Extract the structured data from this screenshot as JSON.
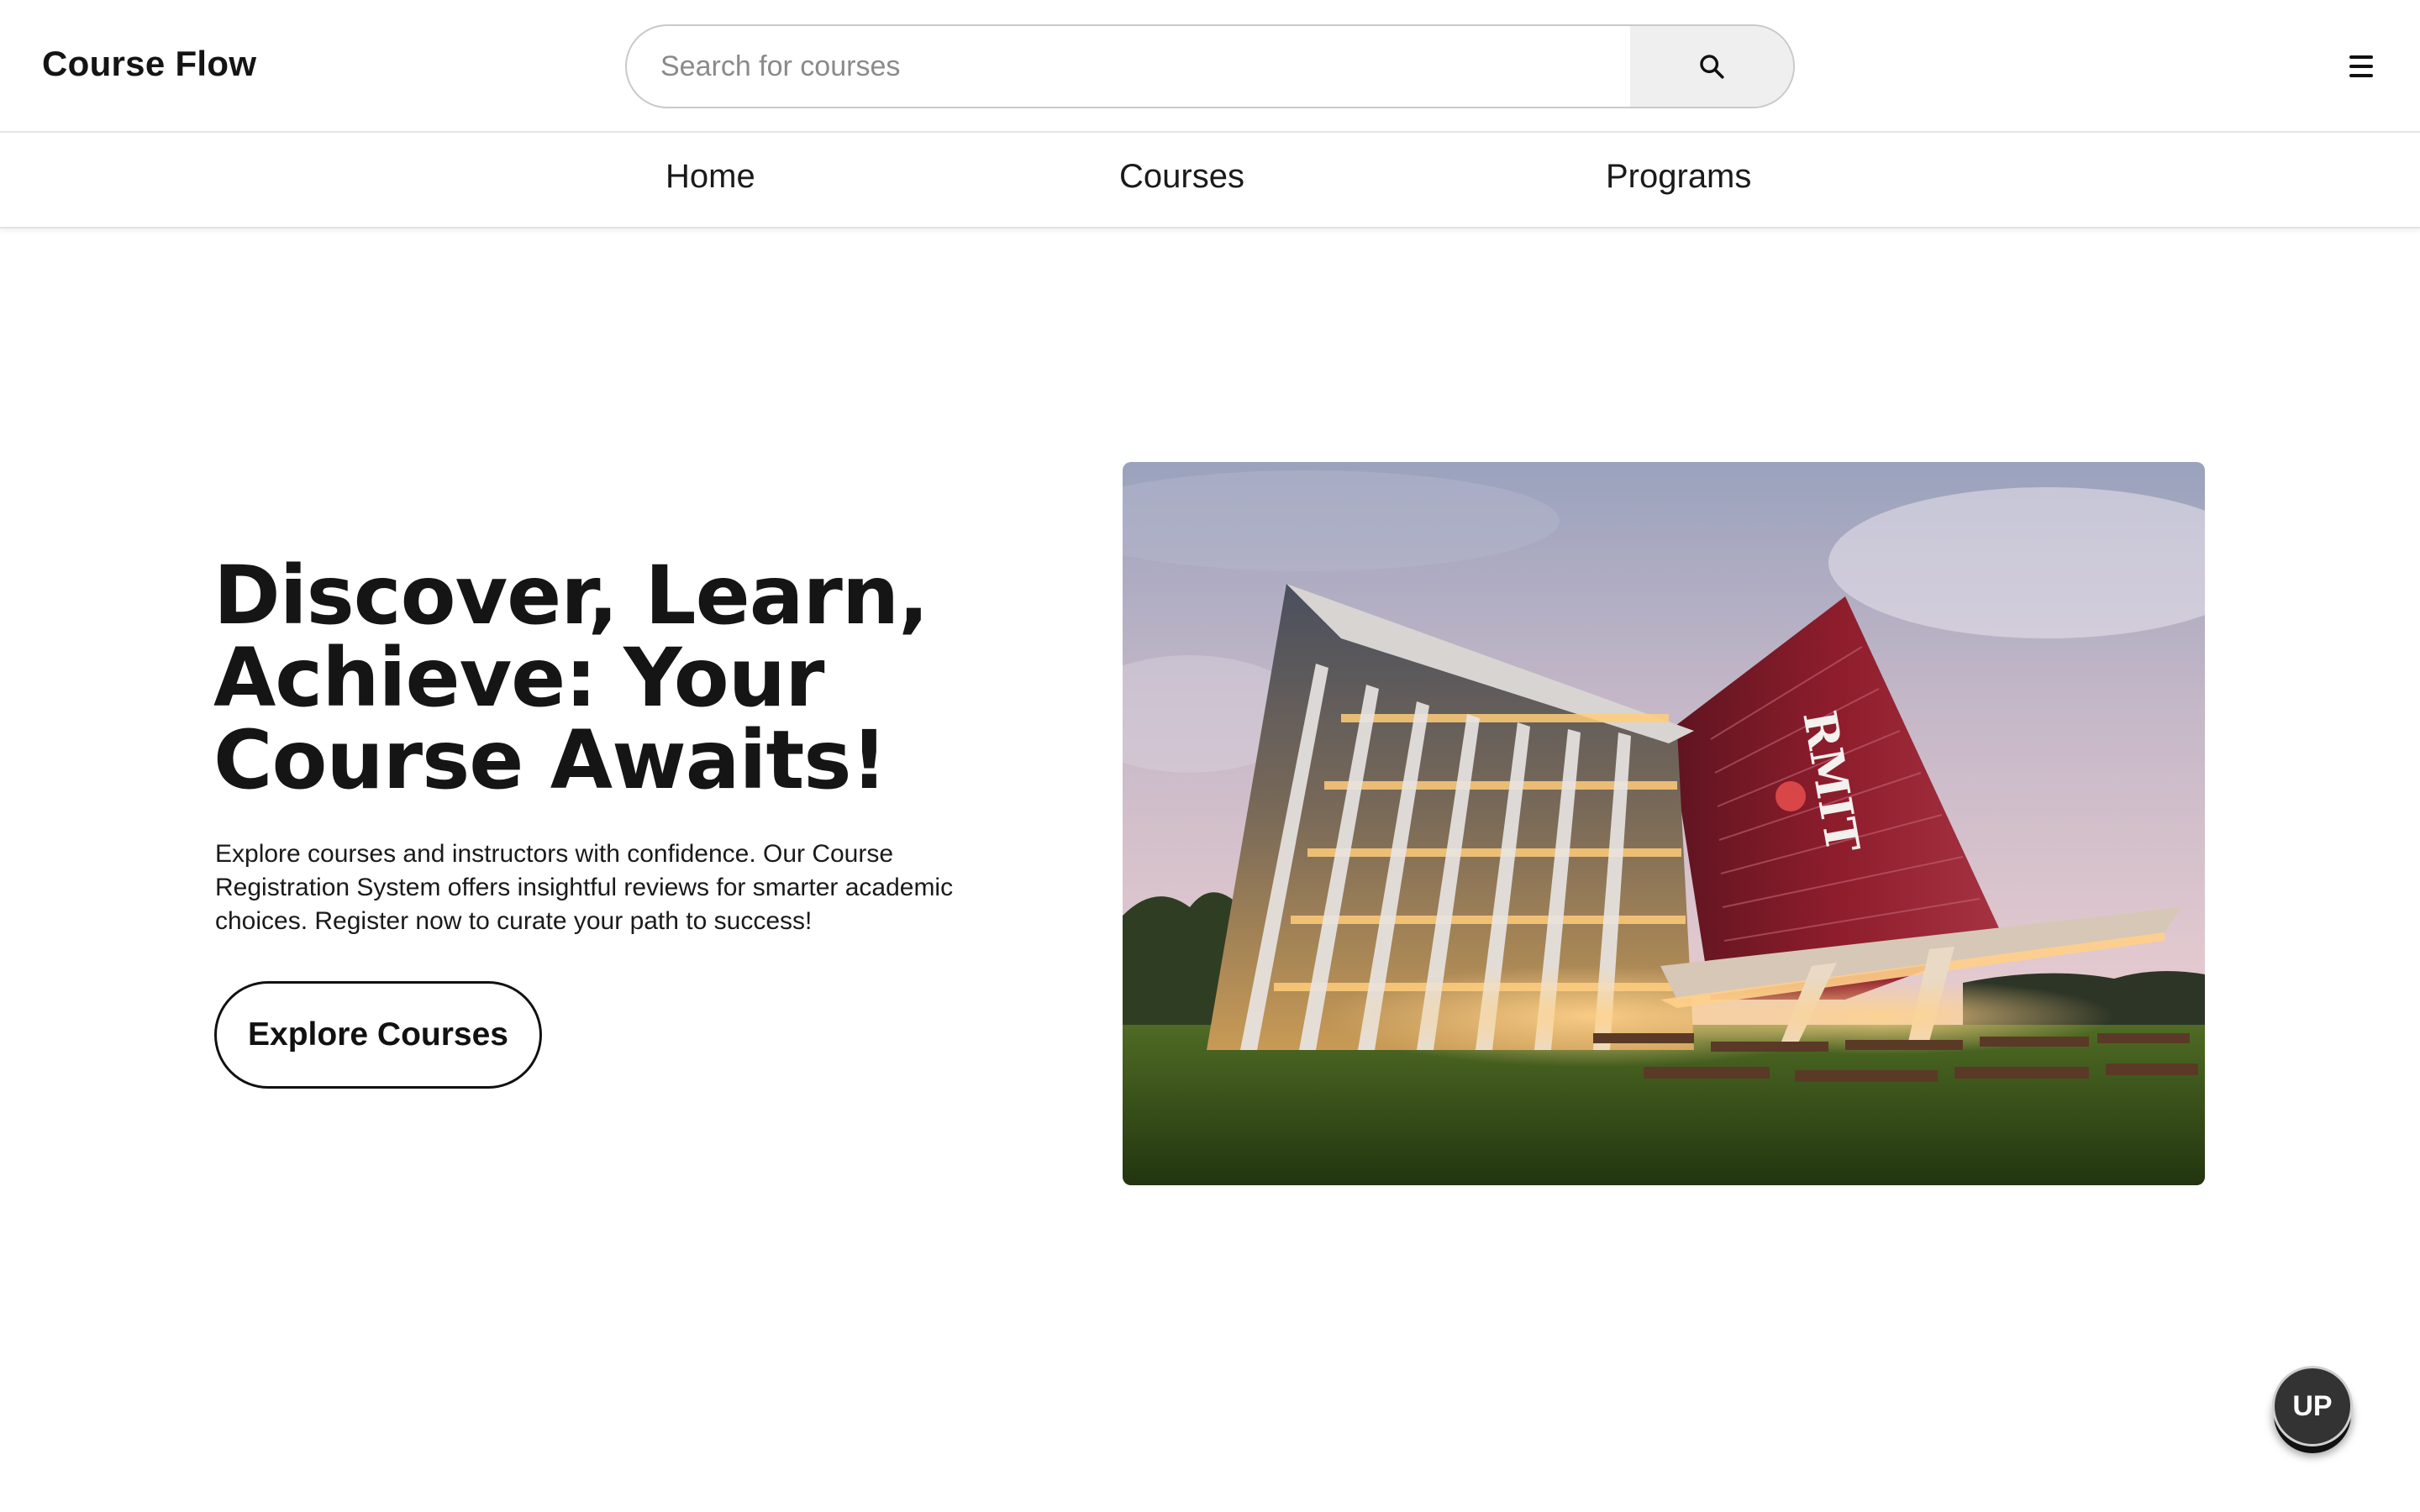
{
  "header": {
    "brand": "Course Flow",
    "search": {
      "placeholder": "Search for courses",
      "value": ""
    }
  },
  "nav": {
    "items": [
      {
        "label": "Home"
      },
      {
        "label": "Courses"
      },
      {
        "label": "Programs"
      }
    ]
  },
  "hero": {
    "title_lines": [
      "Discover, Learn,",
      "Achieve: Your",
      "Course Awaits!"
    ],
    "description": "Explore courses and instructors with confidence. Our Course Registration System offers insightful reviews for smarter academic choices. Register now to curate your path to success!",
    "cta_label": "Explore Courses",
    "image": {
      "signage_text": "RMIT",
      "description": "campus-building-at-dusk"
    }
  },
  "up_button": {
    "label": "UP"
  },
  "icons": {
    "search": "search-icon",
    "menu": "hamburger-menu-icon"
  },
  "colors": {
    "text": "#111111",
    "search_button_bg": "#efefef",
    "building_red": "#8e1d2c",
    "up_button_bg": "#333333"
  }
}
